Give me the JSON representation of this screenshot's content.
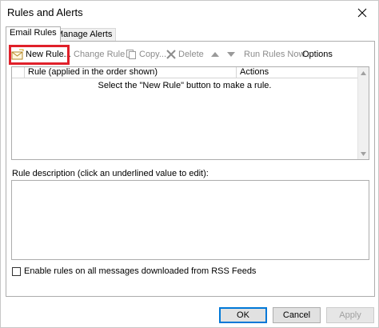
{
  "window": {
    "title": "Rules and Alerts"
  },
  "tabs": [
    {
      "label": "Email Rules",
      "active": true
    },
    {
      "label": "Manage Alerts",
      "active": false
    }
  ],
  "toolbar": {
    "new_rule": "New Rule...",
    "change_rule": "Change Rule",
    "copy": "Copy...",
    "delete": "Delete",
    "run_rules_now": "Run Rules Now...",
    "options": "Options"
  },
  "rules_grid": {
    "columns": [
      "Rule (applied in the order shown)",
      "Actions"
    ],
    "empty_message": "Select the \"New Rule\" button to make a rule."
  },
  "description": {
    "label": "Rule description (click an underlined value to edit):"
  },
  "rss": {
    "label": "Enable rules on all messages downloaded from RSS Feeds",
    "checked": false
  },
  "buttons": {
    "ok": "OK",
    "cancel": "Cancel",
    "apply": "Apply"
  },
  "colors": {
    "highlight": "#e0202a",
    "default_button_border": "#0078d7"
  }
}
